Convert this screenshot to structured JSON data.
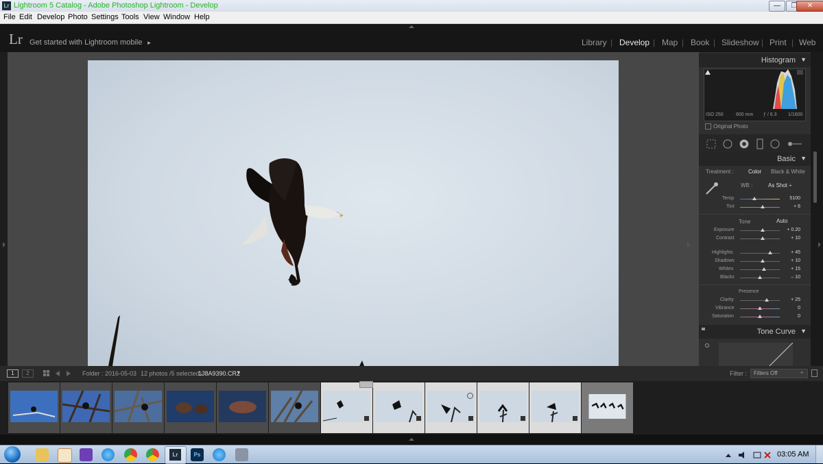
{
  "window": {
    "title": "Lightroom 5 Catalog - Adobe Photoshop Lightroom - Develop",
    "app_icon": "Lr",
    "buttons": {
      "minimize": "—",
      "maximize": "❐",
      "close": "✕"
    }
  },
  "menu": [
    "File",
    "Edit",
    "Develop",
    "Photo",
    "Settings",
    "Tools",
    "View",
    "Window",
    "Help"
  ],
  "header": {
    "logo": "Lr",
    "mobile_prompt": "Get started with Lightroom mobile",
    "mobile_arrow": "►",
    "modules": [
      "Library",
      "Develop",
      "Map",
      "Book",
      "Slideshow",
      "Print",
      "Web"
    ],
    "active_module": "Develop",
    "separator": "|"
  },
  "histogram": {
    "title": "Histogram",
    "iso": "ISO 250",
    "focal": "600 mm",
    "aperture": "ƒ / 6.3",
    "shutter": "1/1600",
    "original_photo": "Original Photo"
  },
  "basic": {
    "title": "Basic",
    "treatment_label": "Treatment :",
    "treatment_color": "Color",
    "treatment_bw": "Black & White",
    "wb_label": "WB :",
    "wb_value": "As Shot ÷",
    "temp_label": "Temp",
    "temp_value": "5100",
    "tint_label": "Tint",
    "tint_value": "+ 6",
    "tone_label": "Tone",
    "auto_label": "Auto",
    "exposure_label": "Exposure",
    "exposure_value": "+ 0.20",
    "contrast_label": "Contrast",
    "contrast_value": "+ 10",
    "highlights_label": "Highlights",
    "highlights_value": "+ 45",
    "shadows_label": "Shadows",
    "shadows_value": "+ 10",
    "whites_label": "Whites",
    "whites_value": "+ 15",
    "blacks_label": "Blacks",
    "blacks_value": "– 10",
    "presence_label": "Presence",
    "clarity_label": "Clarity",
    "clarity_value": "+ 25",
    "vibrance_label": "Vibrance",
    "vibrance_value": "0",
    "saturation_label": "Saturation",
    "saturation_value": "0"
  },
  "tone_curve": {
    "title": "Tone Curve"
  },
  "filmstrip_bar": {
    "view1": "1",
    "view2": "2",
    "folder": "Folder : 2016-05-03",
    "count": "12 photos /5 selected /",
    "filename": "1J8A9390.CR2",
    "filter_label": "Filter :",
    "filter_value": "Filters Off"
  },
  "taskbar": {
    "time": "03:05 AM",
    "icons": [
      "start-orb",
      "explorer",
      "media-player",
      "visual-studio",
      "ie",
      "chrome",
      "chrome-alt",
      "lightroom",
      "photoshop",
      "ie-alt",
      "archive"
    ],
    "lr_label": "Lr",
    "ps_label": "Ps"
  }
}
